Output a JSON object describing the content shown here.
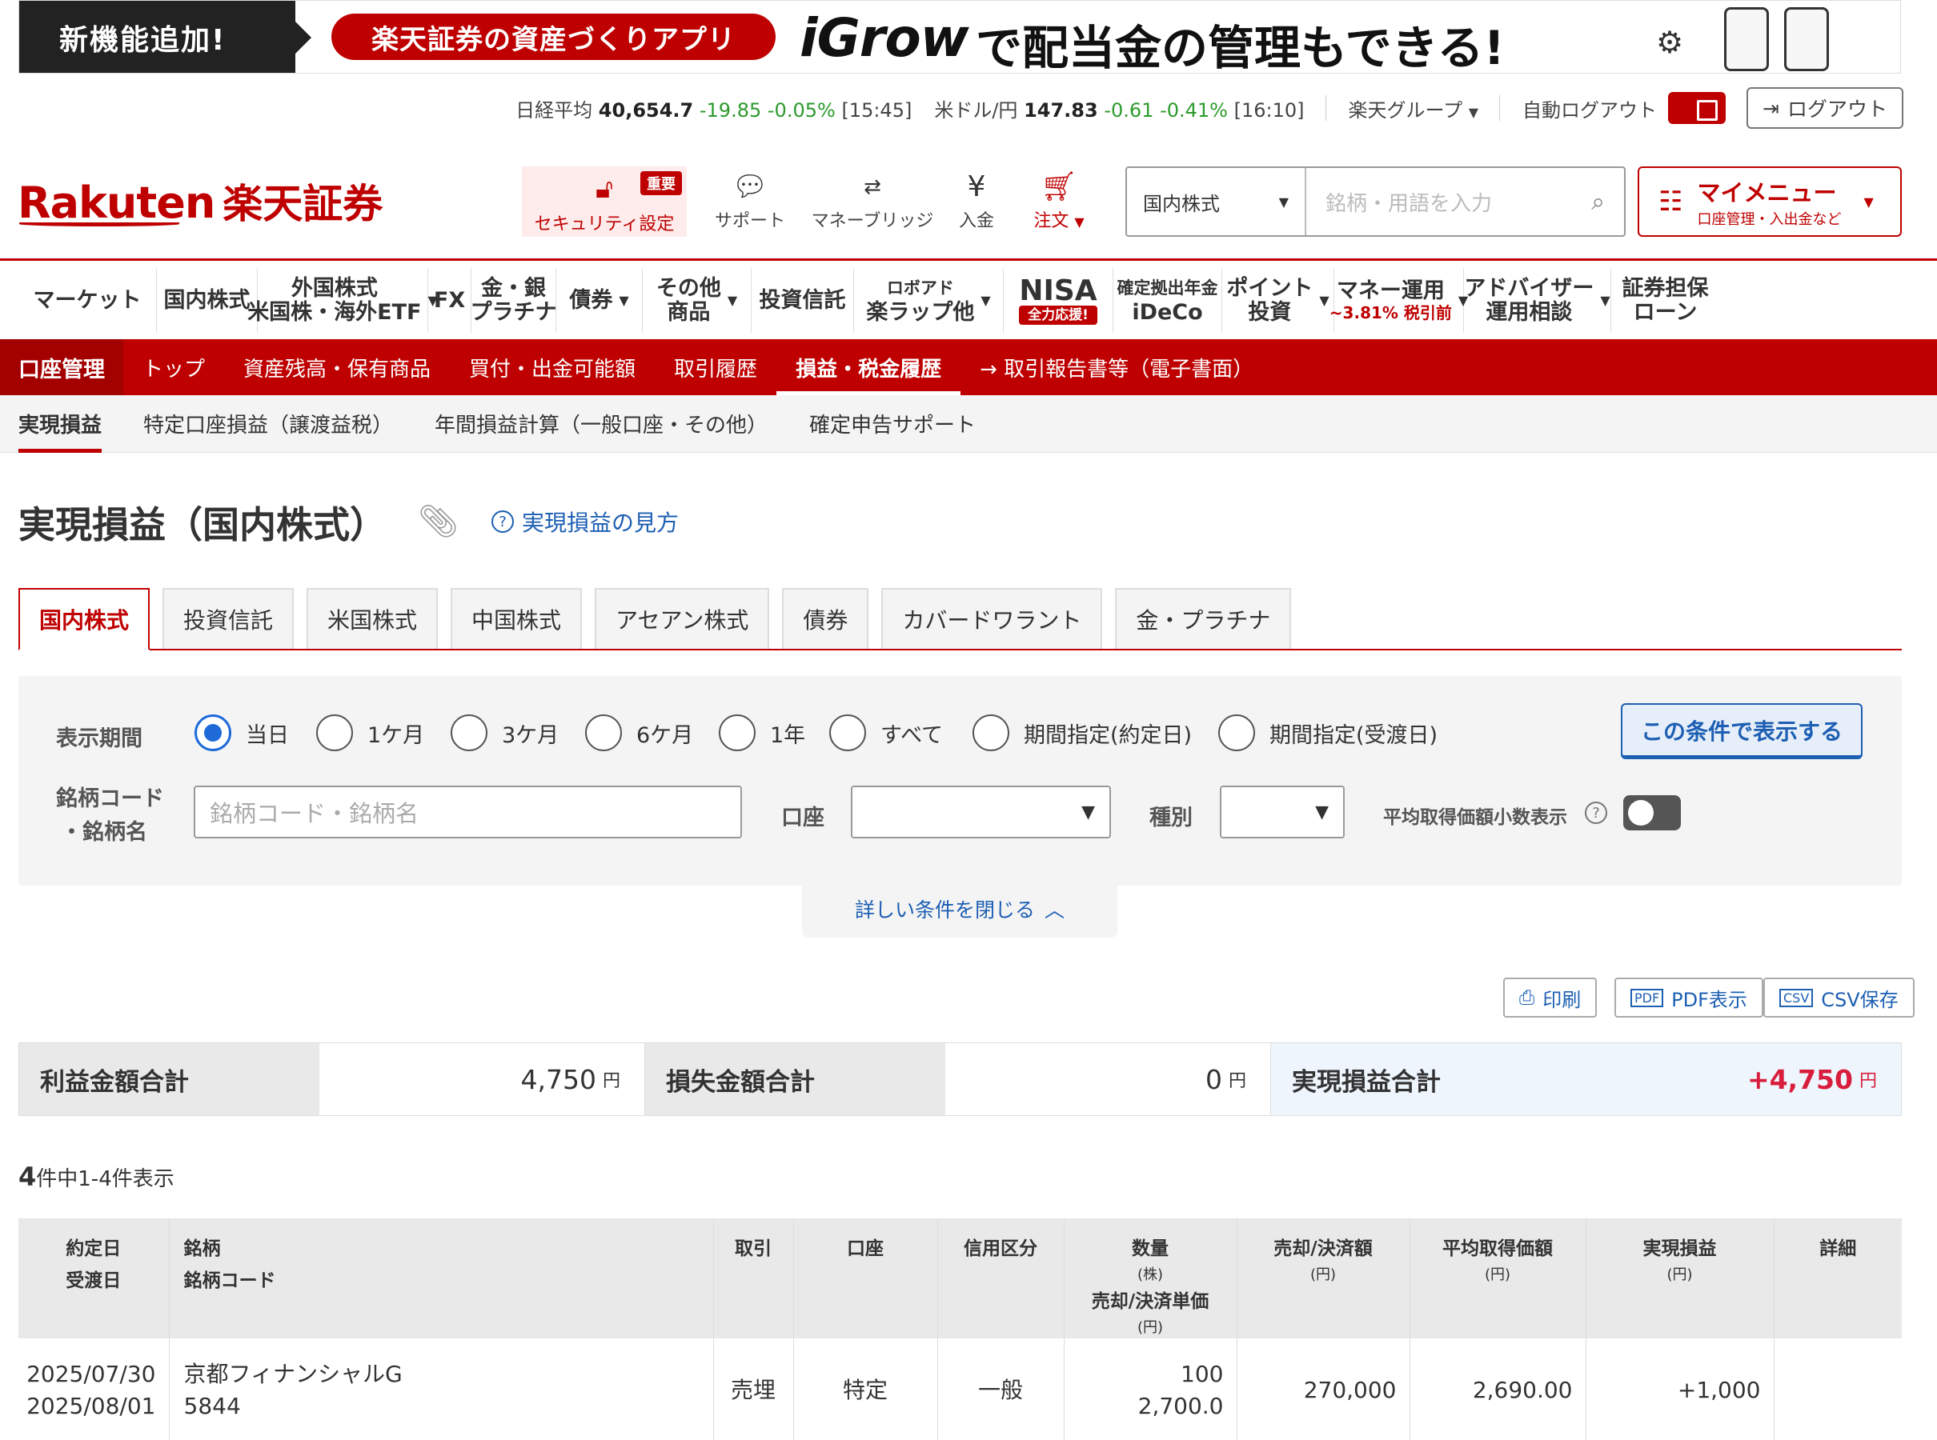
{
  "banner": {
    "left": "新機能追加!",
    "pill": "楽天証券の資産づくりアプリ",
    "brand": "iGrow",
    "tail": "で配当金の管理もできる!"
  },
  "ticker": {
    "nikkei_label": "日経平均",
    "nikkei_value": "40,654.7",
    "nikkei_change": "-19.85",
    "nikkei_pct": "-0.05%",
    "nikkei_time": "[15:45]",
    "usd_label": "米ドル/円",
    "usd_value": "147.83",
    "usd_change": "-0.61",
    "usd_pct": "-0.41%",
    "usd_time": "[16:10]",
    "group": "楽天グループ",
    "autologout": "自動ログアウト",
    "logout": "ログアウト"
  },
  "header": {
    "logo_en": "Rakuten",
    "logo_jp": "楽天証券",
    "security": "セキュリティ設定",
    "security_badge": "重要",
    "support": "サポート",
    "moneybridge": "マネーブリッジ",
    "deposit": "入金",
    "order": "注文",
    "search_category": "国内株式",
    "search_placeholder": "銘柄・用語を入力",
    "mymenu": "マイメニュー",
    "mymenu_sub": "口座管理・入出金など"
  },
  "gnav": [
    {
      "label": "マーケット"
    },
    {
      "label": "国内株式"
    },
    {
      "label": "外国株式",
      "sub": "米国株・海外ETF",
      "dd": true
    },
    {
      "label": "FX"
    },
    {
      "label": "金・銀",
      "sub": "プラチナ"
    },
    {
      "label": "債券",
      "dd": true
    },
    {
      "label": "その他",
      "sub": "商品",
      "dd": true
    },
    {
      "label": "投資信託"
    },
    {
      "label": "ロボアド",
      "sub": "楽ラップ他",
      "dd": true,
      "smalltop": true
    },
    {
      "label": "NISA",
      "sub": "全力応援!",
      "nisa": true
    },
    {
      "label": "確定拠出年金",
      "sub": "iDeCo",
      "smalltop": true
    },
    {
      "label": "ポイント",
      "sub": "投資",
      "dd": true
    },
    {
      "label": "マネー運用",
      "sub": "~3.81% 税引前",
      "dd": true,
      "money": true
    },
    {
      "label": "アドバイザー",
      "sub": "運用相談",
      "dd": true
    },
    {
      "label": "証券担保",
      "sub": "ローン"
    }
  ],
  "rnav": {
    "title": "口座管理",
    "items": [
      "トップ",
      "資産残高・保有商品",
      "買付・出金可能額",
      "取引履歴",
      "損益・税金履歴",
      "→ 取引報告書等（電子書面）"
    ],
    "active": 4
  },
  "snav": {
    "items": [
      "実現損益",
      "特定口座損益（譲渡益税）",
      "年間損益計算（一般口座・その他）",
      "確定申告サポート"
    ],
    "active": 0
  },
  "page": {
    "title": "実現損益（国内株式）",
    "howto": "実現損益の見方"
  },
  "mtabs": {
    "items": [
      "国内株式",
      "投資信託",
      "米国株式",
      "中国株式",
      "アセアン株式",
      "債券",
      "カバードワラント",
      "金・プラチナ"
    ],
    "active": 0
  },
  "filter": {
    "period_label": "表示期間",
    "periods": [
      "当日",
      "1ケ月",
      "3ケ月",
      "6ケ月",
      "1年",
      "すべて",
      "期間指定(約定日)",
      "期間指定(受渡日)"
    ],
    "period_selected": 0,
    "show_button": "この条件で表示する",
    "code_label1": "銘柄コード",
    "code_label2": "・銘柄名",
    "code_placeholder": "銘柄コード・銘柄名",
    "account_label": "口座",
    "type_label": "種別",
    "decimal_label": "平均取得価額小数表示",
    "close_link": "詳しい条件を閉じる"
  },
  "actions": {
    "print": "印刷",
    "pdf": "PDF表示",
    "csv": "CSV保存"
  },
  "summary": {
    "profit_label": "利益金額合計",
    "profit_value": "4,750",
    "loss_label": "損失金額合計",
    "loss_value": "0",
    "total_label": "実現損益合計",
    "total_value": "+4,750",
    "unit": "円"
  },
  "count": {
    "total": "4",
    "rest": "件中1-4件表示"
  },
  "table": {
    "headers": {
      "date1": "約定日",
      "date2": "受渡日",
      "stock1": "銘柄",
      "stock2": "銘柄コード",
      "trade": "取引",
      "account": "口座",
      "credit": "信用区分",
      "qty": "数量",
      "qty_unit": "(株)",
      "price": "売却/決済単価",
      "price_unit": "(円)",
      "amount": "売却/決済額",
      "amount_unit": "(円)",
      "avg": "平均取得価額",
      "avg_unit": "(円)",
      "pl": "実現損益",
      "pl_unit": "(円)",
      "detail": "詳細"
    },
    "rows": [
      {
        "trade_date": "2025/07/30",
        "settle_date": "2025/08/01",
        "name": "京都フィナンシャルG",
        "code": "5844",
        "trade": "売埋",
        "account": "特定",
        "credit": "一般",
        "qty": "100",
        "price": "2,700.0",
        "amount": "270,000",
        "avg": "2,690.00",
        "pl": "+1,000"
      }
    ]
  }
}
